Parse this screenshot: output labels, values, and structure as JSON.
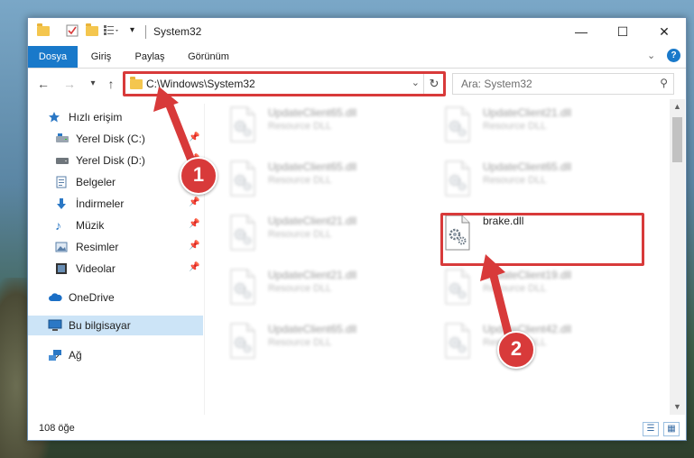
{
  "window": {
    "title": "System32",
    "controls": {
      "minimize": "—",
      "maximize": "☐",
      "close": "✕"
    }
  },
  "ribbon": {
    "tabs": [
      {
        "label": "Dosya",
        "active": true
      },
      {
        "label": "Giriş",
        "active": false
      },
      {
        "label": "Paylaş",
        "active": false
      },
      {
        "label": "Görünüm",
        "active": false
      }
    ],
    "expand_icon": "chevron-down-icon",
    "help_icon": "help-icon"
  },
  "address": {
    "path": "C:\\Windows\\System32",
    "back": "←",
    "forward": "→",
    "recent": "▾",
    "up": "↑",
    "refresh": "↻"
  },
  "search": {
    "placeholder": "Ara: System32"
  },
  "sidebar": {
    "items": [
      {
        "label": "Hızlı erişim",
        "icon": "star-icon"
      },
      {
        "label": "Yerel Disk (C:)",
        "icon": "drive-icon",
        "pin": "📌"
      },
      {
        "label": "Yerel Disk (D:)",
        "icon": "drive-icon",
        "pin": "📌"
      },
      {
        "label": "Belgeler",
        "icon": "documents-icon",
        "pin": "📌"
      },
      {
        "label": "İndirmeler",
        "icon": "downloads-icon",
        "pin": "📌"
      },
      {
        "label": "Müzik",
        "icon": "music-icon",
        "pin": "📌"
      },
      {
        "label": "Resimler",
        "icon": "pictures-icon",
        "pin": "📌"
      },
      {
        "label": "Videolar",
        "icon": "videos-icon",
        "pin": "📌"
      },
      {
        "label": "OneDrive",
        "icon": "cloud-icon"
      },
      {
        "label": "Bu bilgisayar",
        "icon": "computer-icon"
      },
      {
        "label": "Ağ",
        "icon": "network-icon"
      }
    ]
  },
  "files": [
    {
      "name": "UpdateClient65.dll",
      "type": "Resource DLL"
    },
    {
      "name": "UpdateClient21.dll",
      "type": "Resource DLL"
    },
    {
      "name": "UpdateClient65.dll",
      "type": "Resource DLL"
    },
    {
      "name": "UpdateClient65.dll",
      "type": "Resource DLL"
    },
    {
      "name": "UpdateClient21.dll",
      "type": "Resource DLL"
    },
    {
      "name": "brake.dll",
      "type": ""
    },
    {
      "name": "UpdateClient21.dll",
      "type": "Resource DLL"
    },
    {
      "name": "UpdateClient19.dll",
      "type": "Resource DLL"
    },
    {
      "name": "UpdateClient65.dll",
      "type": "Resource DLL"
    },
    {
      "name": "UpdateClient42.dll",
      "type": "Resource DLL"
    }
  ],
  "status": {
    "count": "108 öğe"
  },
  "annotations": {
    "badge1": "1",
    "badge2": "2"
  },
  "colors": {
    "accent": "#1979ca",
    "highlight": "#d83a3a",
    "selected": "#cce4f7"
  }
}
